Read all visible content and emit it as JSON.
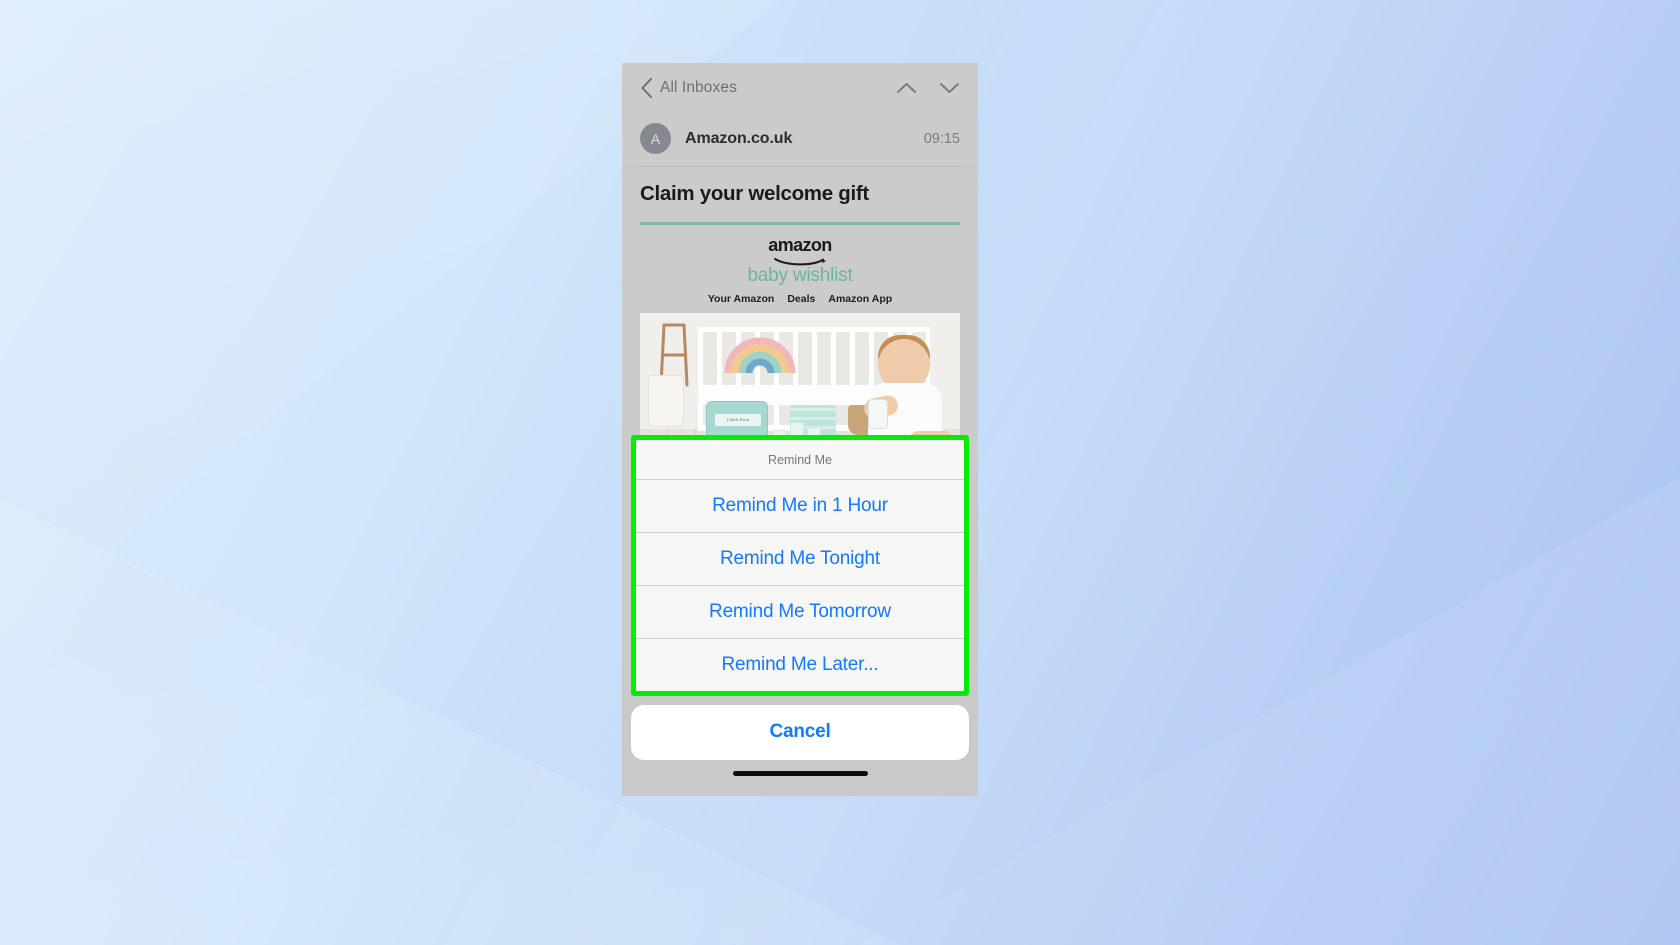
{
  "background": {
    "color_light": "#d3e7fa",
    "color_deep": "#a8c2f0"
  },
  "phone": {
    "navbar": {
      "back_icon": "chevron-left-icon",
      "back_label": "All Inboxes",
      "up_icon": "chevron-up-icon",
      "down_icon": "chevron-down-icon"
    },
    "message": {
      "avatar_initial": "A",
      "sender": "Amazon.co.uk",
      "time": "09:15",
      "subject": "Claim your welcome gift"
    },
    "email": {
      "brand_word": "amazon",
      "brand_tagline": "baby wishlist",
      "brand_rule_color": "#7fb8a5",
      "tagline_color": "#6fb3a0",
      "nav_links": [
        "Your Amazon",
        "Deals",
        "Amazon App"
      ],
      "hero_alt": "baby-nursery-photo",
      "hero_case_label": "Childs Farm"
    },
    "action_sheet": {
      "highlight_color": "#00ee00",
      "header": "Remind Me",
      "options": [
        "Remind Me in 1 Hour",
        "Remind Me Tonight",
        "Remind Me Tomorrow",
        "Remind Me Later..."
      ],
      "cancel_label": "Cancel",
      "accent_color": "#1479ff"
    },
    "home_indicator": "home-indicator-bar"
  }
}
